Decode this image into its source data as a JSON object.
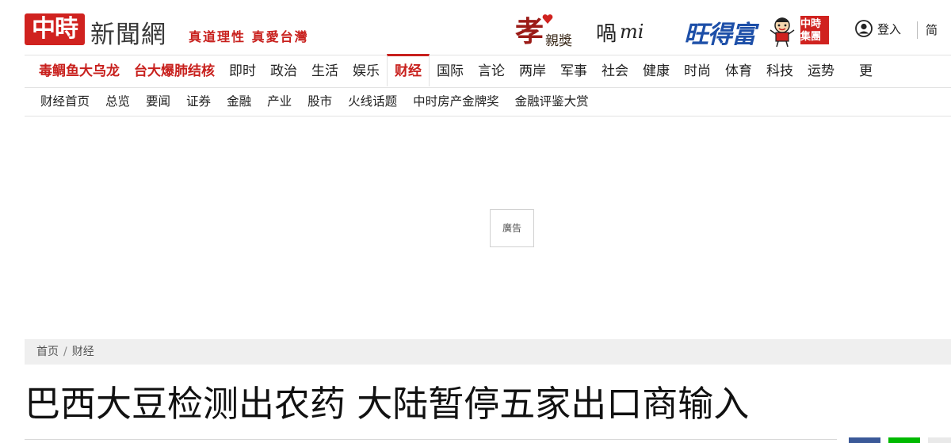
{
  "header": {
    "logo_mark": "中時",
    "logo_text": "新聞網",
    "slogan": "真道理性 真愛台灣",
    "partners": {
      "xiao_big": "孝",
      "xiao_small": "親獎",
      "wo": "喎",
      "wo_tail": "mi",
      "want": "旺得富",
      "group_line1": "中時",
      "group_line2": "集團"
    },
    "login_label": "登入",
    "lang_label": "简"
  },
  "main_nav": {
    "items": [
      {
        "label": "毒鲷鱼大乌龙"
      },
      {
        "label": "台大爆肺结核"
      },
      {
        "label": "即时"
      },
      {
        "label": "政治"
      },
      {
        "label": "生活"
      },
      {
        "label": "娱乐"
      },
      {
        "label": "财经"
      },
      {
        "label": "国际"
      },
      {
        "label": "言论"
      },
      {
        "label": "两岸"
      },
      {
        "label": "军事"
      },
      {
        "label": "社会"
      },
      {
        "label": "健康"
      },
      {
        "label": "时尚"
      },
      {
        "label": "体育"
      },
      {
        "label": "科技"
      },
      {
        "label": "运势"
      },
      {
        "label": "更"
      }
    ],
    "active": "财经"
  },
  "sub_nav": {
    "items": [
      {
        "label": "财经首页"
      },
      {
        "label": "总览"
      },
      {
        "label": "要闻"
      },
      {
        "label": "证券"
      },
      {
        "label": "金融"
      },
      {
        "label": "产业"
      },
      {
        "label": "股市"
      },
      {
        "label": "火线话题"
      },
      {
        "label": "中时房产金牌奖"
      },
      {
        "label": "金融评鉴大赏"
      }
    ]
  },
  "ad": {
    "label": "廣告"
  },
  "breadcrumb": {
    "home": "首页",
    "separator": "/",
    "current": "财经"
  },
  "article": {
    "title": "巴西大豆检测出农药 大陆暂停五家出口商输入"
  },
  "colors": {
    "brand_red": "#d0221f",
    "accent_red": "#c8201d",
    "want_blue": "#1d4fa8",
    "facebook": "#3b5998",
    "line": "#00b900"
  }
}
